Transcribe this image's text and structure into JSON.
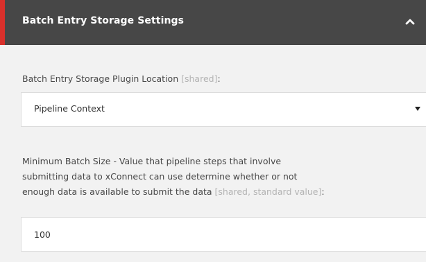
{
  "section": {
    "title": "Batch Entry Storage Settings",
    "collapse_icon": "chevron-up-icon"
  },
  "fields": {
    "storage_plugin": {
      "label": "Batch Entry Storage Plugin Location ",
      "qualifier": "[shared]",
      "suffix": ":",
      "selected": "Pipeline Context"
    },
    "min_batch_size": {
      "label_line1": "Minimum Batch Size - Value that pipeline steps that involve",
      "label_line2": "submitting data to xConnect can use determine whether or not",
      "label_line3": "enough data is available to submit the data ",
      "qualifier": "[shared, standard value]",
      "suffix": ":",
      "value": "100"
    }
  },
  "colors": {
    "header_bg": "#474747",
    "accent": "#d9302b",
    "panel_bg": "#f2f2f2",
    "qualifier": "#b3b3b3"
  }
}
